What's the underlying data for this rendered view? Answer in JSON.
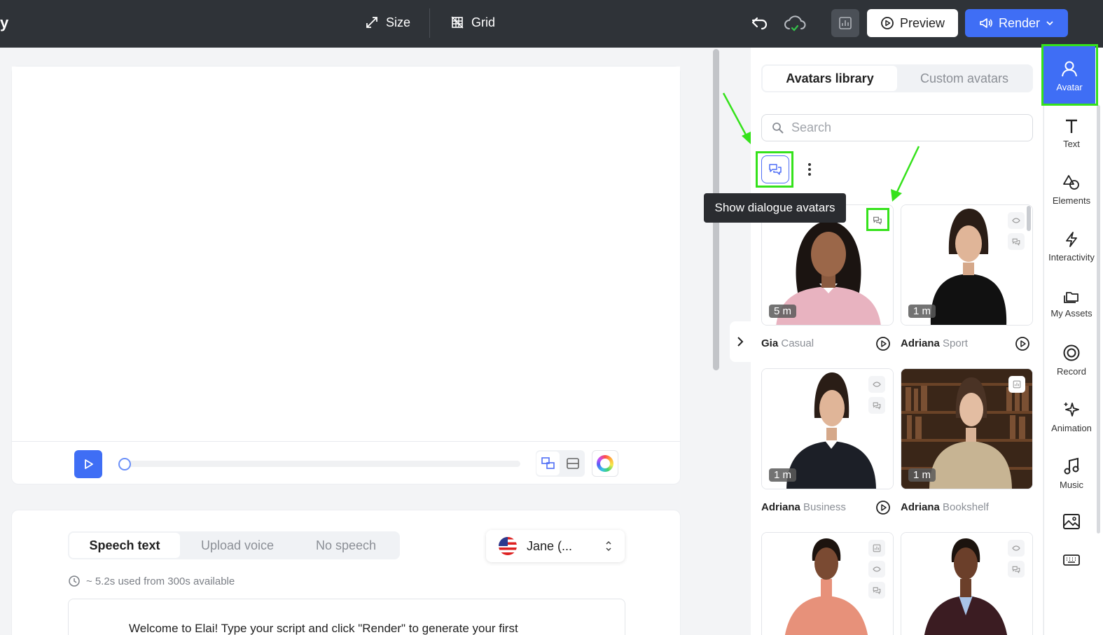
{
  "topbar": {
    "brand_fragment": "y",
    "size_label": "Size",
    "grid_label": "Grid",
    "preview_label": "Preview",
    "render_label": "Render"
  },
  "speech": {
    "tabs": [
      "Speech text",
      "Upload voice",
      "No speech"
    ],
    "active_tab": "Speech text",
    "voice": "Jane (...",
    "usage": "~ 5.2s used from 300s available",
    "script_text": "Welcome to Elai! Type your script and click \"Render\" to generate your first"
  },
  "avatars": {
    "tabs": [
      "Avatars library",
      "Custom avatars"
    ],
    "active_tab": "Avatars library",
    "search_placeholder": "Search",
    "tooltip": "Show dialogue avatars",
    "cards": [
      {
        "name": "Gia",
        "variant": "Casual",
        "duration": "5 m"
      },
      {
        "name": "Adriana",
        "variant": "Sport",
        "duration": "1 m"
      },
      {
        "name": "Adriana",
        "variant": "Business",
        "duration": "1 m"
      },
      {
        "name": "Adriana",
        "variant": "Bookshelf",
        "duration": "1 m"
      },
      {
        "name": "",
        "variant": "",
        "duration": ""
      },
      {
        "name": "",
        "variant": "",
        "duration": ""
      }
    ]
  },
  "rail": {
    "items": [
      "Avatar",
      "Text",
      "Elements",
      "Interactivity",
      "My Assets",
      "Record",
      "Animation",
      "Music"
    ],
    "active": "Avatar"
  },
  "colors": {
    "accent": "#3f6ef5",
    "topbar": "#2f3338",
    "highlight": "#35e21b"
  }
}
